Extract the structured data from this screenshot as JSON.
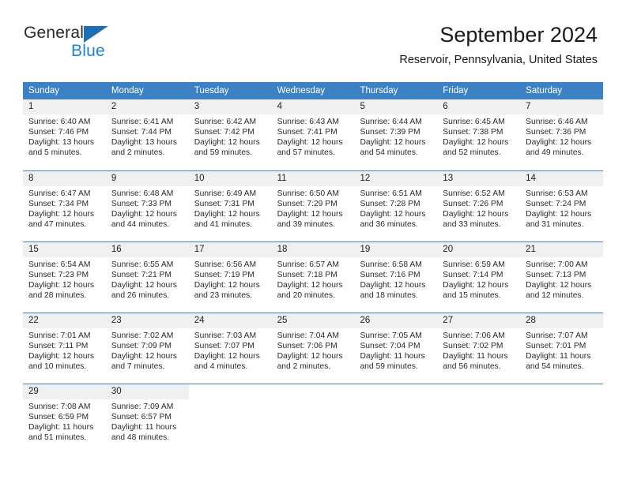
{
  "brand": {
    "name_part1": "General",
    "name_part2": "Blue",
    "triangle_color": "#1f6fb5",
    "blue_text_color": "#1f82d8"
  },
  "header": {
    "title": "September 2024",
    "location": "Reservoir, Pennsylvania, United States"
  },
  "theme": {
    "header_bar_color": "#3c81c4",
    "day_band_color": "#f0f0f0",
    "text_color": "#2a2a2a"
  },
  "weekdays": [
    "Sunday",
    "Monday",
    "Tuesday",
    "Wednesday",
    "Thursday",
    "Friday",
    "Saturday"
  ],
  "weeks": [
    [
      {
        "day": "1",
        "sunrise": "Sunrise: 6:40 AM",
        "sunset": "Sunset: 7:46 PM",
        "daylight1": "Daylight: 13 hours",
        "daylight2": "and 5 minutes."
      },
      {
        "day": "2",
        "sunrise": "Sunrise: 6:41 AM",
        "sunset": "Sunset: 7:44 PM",
        "daylight1": "Daylight: 13 hours",
        "daylight2": "and 2 minutes."
      },
      {
        "day": "3",
        "sunrise": "Sunrise: 6:42 AM",
        "sunset": "Sunset: 7:42 PM",
        "daylight1": "Daylight: 12 hours",
        "daylight2": "and 59 minutes."
      },
      {
        "day": "4",
        "sunrise": "Sunrise: 6:43 AM",
        "sunset": "Sunset: 7:41 PM",
        "daylight1": "Daylight: 12 hours",
        "daylight2": "and 57 minutes."
      },
      {
        "day": "5",
        "sunrise": "Sunrise: 6:44 AM",
        "sunset": "Sunset: 7:39 PM",
        "daylight1": "Daylight: 12 hours",
        "daylight2": "and 54 minutes."
      },
      {
        "day": "6",
        "sunrise": "Sunrise: 6:45 AM",
        "sunset": "Sunset: 7:38 PM",
        "daylight1": "Daylight: 12 hours",
        "daylight2": "and 52 minutes."
      },
      {
        "day": "7",
        "sunrise": "Sunrise: 6:46 AM",
        "sunset": "Sunset: 7:36 PM",
        "daylight1": "Daylight: 12 hours",
        "daylight2": "and 49 minutes."
      }
    ],
    [
      {
        "day": "8",
        "sunrise": "Sunrise: 6:47 AM",
        "sunset": "Sunset: 7:34 PM",
        "daylight1": "Daylight: 12 hours",
        "daylight2": "and 47 minutes."
      },
      {
        "day": "9",
        "sunrise": "Sunrise: 6:48 AM",
        "sunset": "Sunset: 7:33 PM",
        "daylight1": "Daylight: 12 hours",
        "daylight2": "and 44 minutes."
      },
      {
        "day": "10",
        "sunrise": "Sunrise: 6:49 AM",
        "sunset": "Sunset: 7:31 PM",
        "daylight1": "Daylight: 12 hours",
        "daylight2": "and 41 minutes."
      },
      {
        "day": "11",
        "sunrise": "Sunrise: 6:50 AM",
        "sunset": "Sunset: 7:29 PM",
        "daylight1": "Daylight: 12 hours",
        "daylight2": "and 39 minutes."
      },
      {
        "day": "12",
        "sunrise": "Sunrise: 6:51 AM",
        "sunset": "Sunset: 7:28 PM",
        "daylight1": "Daylight: 12 hours",
        "daylight2": "and 36 minutes."
      },
      {
        "day": "13",
        "sunrise": "Sunrise: 6:52 AM",
        "sunset": "Sunset: 7:26 PM",
        "daylight1": "Daylight: 12 hours",
        "daylight2": "and 33 minutes."
      },
      {
        "day": "14",
        "sunrise": "Sunrise: 6:53 AM",
        "sunset": "Sunset: 7:24 PM",
        "daylight1": "Daylight: 12 hours",
        "daylight2": "and 31 minutes."
      }
    ],
    [
      {
        "day": "15",
        "sunrise": "Sunrise: 6:54 AM",
        "sunset": "Sunset: 7:23 PM",
        "daylight1": "Daylight: 12 hours",
        "daylight2": "and 28 minutes."
      },
      {
        "day": "16",
        "sunrise": "Sunrise: 6:55 AM",
        "sunset": "Sunset: 7:21 PM",
        "daylight1": "Daylight: 12 hours",
        "daylight2": "and 26 minutes."
      },
      {
        "day": "17",
        "sunrise": "Sunrise: 6:56 AM",
        "sunset": "Sunset: 7:19 PM",
        "daylight1": "Daylight: 12 hours",
        "daylight2": "and 23 minutes."
      },
      {
        "day": "18",
        "sunrise": "Sunrise: 6:57 AM",
        "sunset": "Sunset: 7:18 PM",
        "daylight1": "Daylight: 12 hours",
        "daylight2": "and 20 minutes."
      },
      {
        "day": "19",
        "sunrise": "Sunrise: 6:58 AM",
        "sunset": "Sunset: 7:16 PM",
        "daylight1": "Daylight: 12 hours",
        "daylight2": "and 18 minutes."
      },
      {
        "day": "20",
        "sunrise": "Sunrise: 6:59 AM",
        "sunset": "Sunset: 7:14 PM",
        "daylight1": "Daylight: 12 hours",
        "daylight2": "and 15 minutes."
      },
      {
        "day": "21",
        "sunrise": "Sunrise: 7:00 AM",
        "sunset": "Sunset: 7:13 PM",
        "daylight1": "Daylight: 12 hours",
        "daylight2": "and 12 minutes."
      }
    ],
    [
      {
        "day": "22",
        "sunrise": "Sunrise: 7:01 AM",
        "sunset": "Sunset: 7:11 PM",
        "daylight1": "Daylight: 12 hours",
        "daylight2": "and 10 minutes."
      },
      {
        "day": "23",
        "sunrise": "Sunrise: 7:02 AM",
        "sunset": "Sunset: 7:09 PM",
        "daylight1": "Daylight: 12 hours",
        "daylight2": "and 7 minutes."
      },
      {
        "day": "24",
        "sunrise": "Sunrise: 7:03 AM",
        "sunset": "Sunset: 7:07 PM",
        "daylight1": "Daylight: 12 hours",
        "daylight2": "and 4 minutes."
      },
      {
        "day": "25",
        "sunrise": "Sunrise: 7:04 AM",
        "sunset": "Sunset: 7:06 PM",
        "daylight1": "Daylight: 12 hours",
        "daylight2": "and 2 minutes."
      },
      {
        "day": "26",
        "sunrise": "Sunrise: 7:05 AM",
        "sunset": "Sunset: 7:04 PM",
        "daylight1": "Daylight: 11 hours",
        "daylight2": "and 59 minutes."
      },
      {
        "day": "27",
        "sunrise": "Sunrise: 7:06 AM",
        "sunset": "Sunset: 7:02 PM",
        "daylight1": "Daylight: 11 hours",
        "daylight2": "and 56 minutes."
      },
      {
        "day": "28",
        "sunrise": "Sunrise: 7:07 AM",
        "sunset": "Sunset: 7:01 PM",
        "daylight1": "Daylight: 11 hours",
        "daylight2": "and 54 minutes."
      }
    ],
    [
      {
        "day": "29",
        "sunrise": "Sunrise: 7:08 AM",
        "sunset": "Sunset: 6:59 PM",
        "daylight1": "Daylight: 11 hours",
        "daylight2": "and 51 minutes."
      },
      {
        "day": "30",
        "sunrise": "Sunrise: 7:09 AM",
        "sunset": "Sunset: 6:57 PM",
        "daylight1": "Daylight: 11 hours",
        "daylight2": "and 48 minutes."
      },
      {
        "day": "",
        "sunrise": "",
        "sunset": "",
        "daylight1": "",
        "daylight2": ""
      },
      {
        "day": "",
        "sunrise": "",
        "sunset": "",
        "daylight1": "",
        "daylight2": ""
      },
      {
        "day": "",
        "sunrise": "",
        "sunset": "",
        "daylight1": "",
        "daylight2": ""
      },
      {
        "day": "",
        "sunrise": "",
        "sunset": "",
        "daylight1": "",
        "daylight2": ""
      },
      {
        "day": "",
        "sunrise": "",
        "sunset": "",
        "daylight1": "",
        "daylight2": ""
      }
    ]
  ]
}
